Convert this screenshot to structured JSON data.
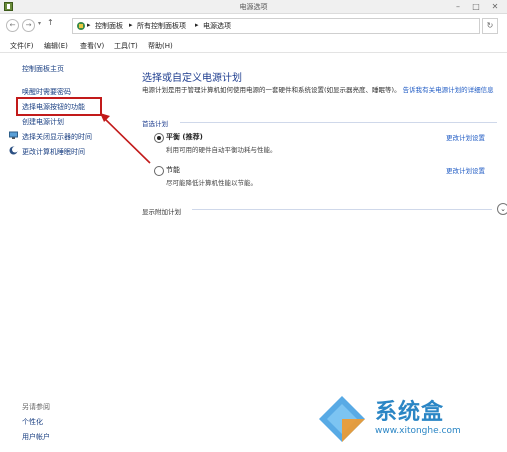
{
  "window": {
    "title": "电源选项"
  },
  "address": {
    "crumbs": [
      "控制面板",
      "所有控制面板项",
      "电源选项"
    ],
    "sep": "▸"
  },
  "menubar": [
    "文件(F)",
    "编辑(E)",
    "查看(V)",
    "工具(T)",
    "帮助(H)"
  ],
  "sidebar": {
    "home": "控制面板主页",
    "items": [
      {
        "label": "唤醒时需要密码"
      },
      {
        "label": "选择电源按钮的功能"
      },
      {
        "label": "创建电源计划"
      },
      {
        "label": "选择关闭显示器的时间",
        "icon": "display-icon"
      },
      {
        "label": "更改计算机睡眠时间",
        "icon": "moon-icon"
      }
    ],
    "see_also_title": "另请参阅",
    "see_also": [
      "个性化",
      "用户帐户"
    ]
  },
  "main": {
    "heading": "选择或自定义电源计划",
    "desc": "电源计划是用于管理计算机如何使用电源的一套硬件和系统设置(如显示器亮度、睡眠等)。",
    "desc_link": "告诉我有关电源计划的详细信息",
    "section_title": "首选计划",
    "plans": [
      {
        "name": "平衡 (推荐)",
        "desc": "利用可用的硬件自动平衡功耗与性能。",
        "link": "更改计划设置",
        "selected": true
      },
      {
        "name": "节能",
        "desc": "尽可能降低计算机性能以节能。",
        "link": "更改计划设置",
        "selected": false
      }
    ],
    "more_plans": "显示附加计划"
  },
  "watermark": {
    "brand": "系统盒",
    "url": "www.xitonghe.com"
  },
  "colors": {
    "link": "#1f5bc4",
    "heading": "#1e3d8f",
    "highlight": "#c21a1a"
  }
}
